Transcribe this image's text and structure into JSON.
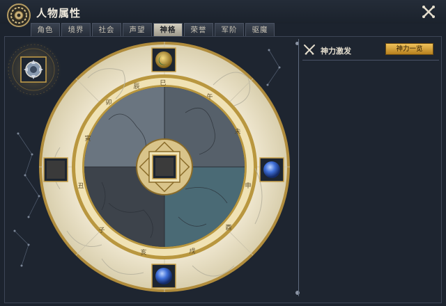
{
  "window": {
    "title": "人物属性"
  },
  "tabs": [
    {
      "label": "角色",
      "active": false
    },
    {
      "label": "境界",
      "active": false
    },
    {
      "label": "社会",
      "active": false
    },
    {
      "label": "声望",
      "active": false
    },
    {
      "label": "神格",
      "active": true
    },
    {
      "label": "荣誉",
      "active": false
    },
    {
      "label": "军阶",
      "active": false
    },
    {
      "label": "驱魔",
      "active": false
    }
  ],
  "right_panel": {
    "title": "神力激发",
    "button_label": "神力一览",
    "icon": "crossed-swords-icon"
  },
  "wheel": {
    "ring_glyphs": [
      "巳",
      "午",
      "未",
      "申",
      "酉",
      "戌",
      "亥",
      "子",
      "丑",
      "寅",
      "卯",
      "辰"
    ],
    "slots": [
      {
        "name": "top-slot",
        "icon": "crescent-moon-orb-icon",
        "filled": true
      },
      {
        "name": "right-slot",
        "icon": "blue-gem-icon",
        "filled": true
      },
      {
        "name": "bottom-slot",
        "icon": "blue-gem-icon",
        "filled": true
      },
      {
        "name": "left-slot",
        "icon": "empty-slot",
        "filled": false
      },
      {
        "name": "center-slot",
        "icon": "empty-slot",
        "filled": false
      }
    ]
  },
  "emblem": {
    "icon": "divine-gem-emblem-icon"
  },
  "colors": {
    "gold": "#c9a24a",
    "panel_bg": "#1e2530",
    "parchment": "#ece4cc",
    "button_gold": "#e0ac3c",
    "gem_blue": "#3f6fd8"
  }
}
